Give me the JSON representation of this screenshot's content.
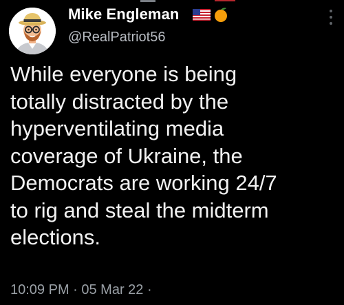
{
  "tweet": {
    "author": {
      "display_name": "Mike Engleman",
      "handle": "@RealPatriot56",
      "badges": [
        "us-flag-icon",
        "orange-fruit-icon"
      ]
    },
    "text_lines": [
      "While everyone is being",
      "totally distracted by the",
      "hyperventilating media",
      "coverage of Ukraine, the",
      "Democrats are working 24/7",
      "to rig and steal the midterm",
      "elections."
    ],
    "timestamp": "10:09 PM · 05 Mar 22 ·"
  },
  "colors": {
    "background": "#000000",
    "text": "#f2f2f2",
    "secondary": "#9aa0a6"
  }
}
